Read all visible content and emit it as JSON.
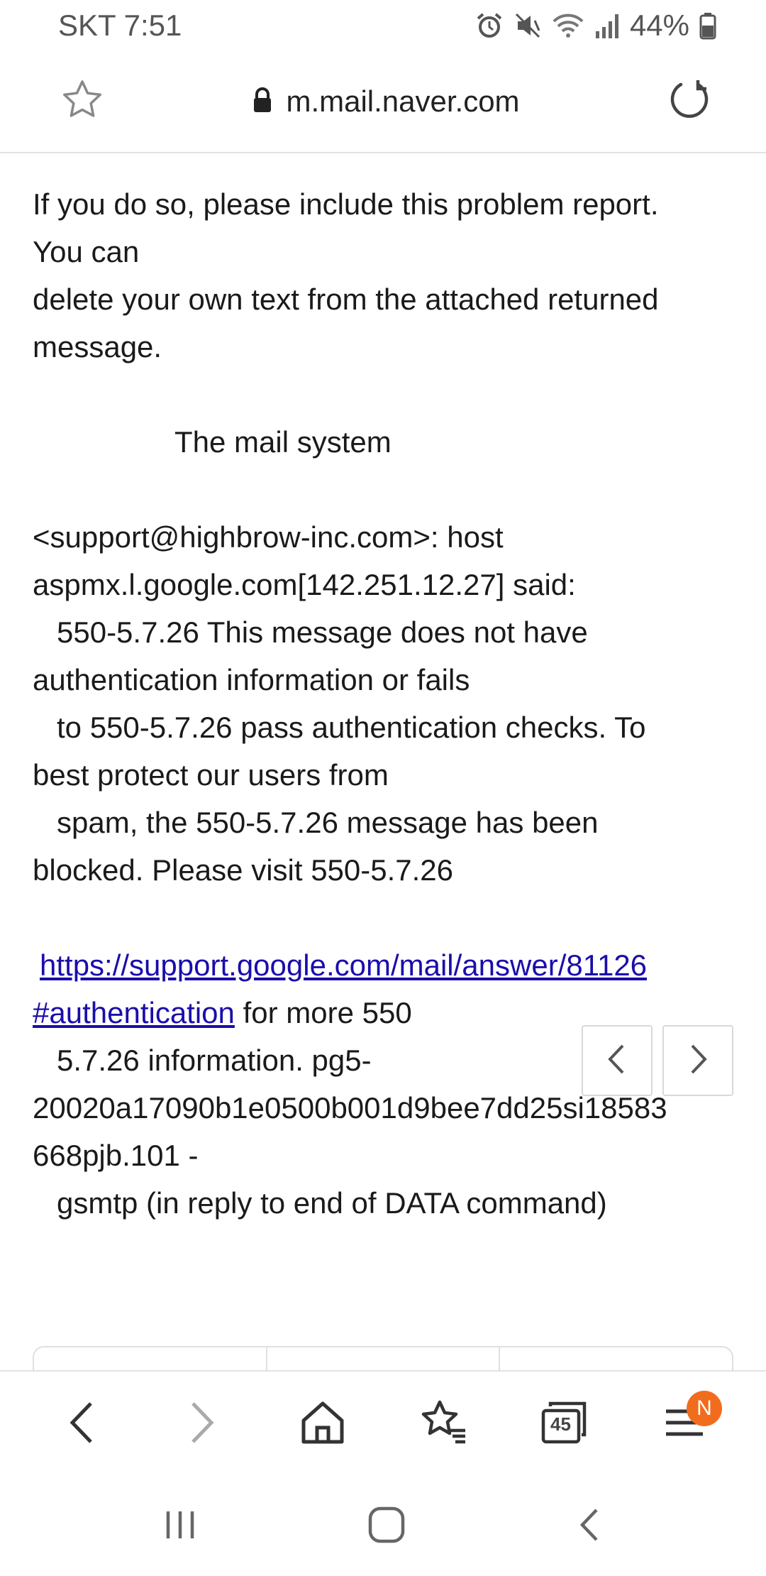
{
  "status_bar": {
    "carrier_time": "SKT 7:51",
    "battery": "44%"
  },
  "browser": {
    "url": "m.mail.naver.com",
    "icons": [
      "star-icon",
      "lock-icon",
      "reload-icon"
    ]
  },
  "mail": {
    "line1": "If you do so, please include this problem report.",
    "line2": "You can",
    "line3": "delete your own text from the attached returned",
    "line4": "message.",
    "signature": "The mail system",
    "recipient": "<support@highbrow-inc.com>: host",
    "host": "aspmx.l.google.com[142.251.12.27] said:",
    "err1": "550-5.7.26 This message does not have",
    "err2": "authentication information or fails",
    "err3": "to 550-5.7.26 pass authentication checks. To",
    "err4": "best protect our users from",
    "err5": "spam, the 550-5.7.26 message has been",
    "err6": "blocked. Please visit 550-5.7.26",
    "link_part1": "https://support.google.com/mail/answer/81126",
    "link_part2": "#authentication",
    "after_link": " for more 550",
    "info1": "5.7.26 information. pg5-",
    "info2": "20020a17090b1e0500b001d9bee7dd25si18583",
    "info3": "668pjb.101 -",
    "info4": "gsmtp (in reply to end of DATA command)"
  },
  "toolbar": {
    "tab_count": "45",
    "menu_badge": "N"
  }
}
